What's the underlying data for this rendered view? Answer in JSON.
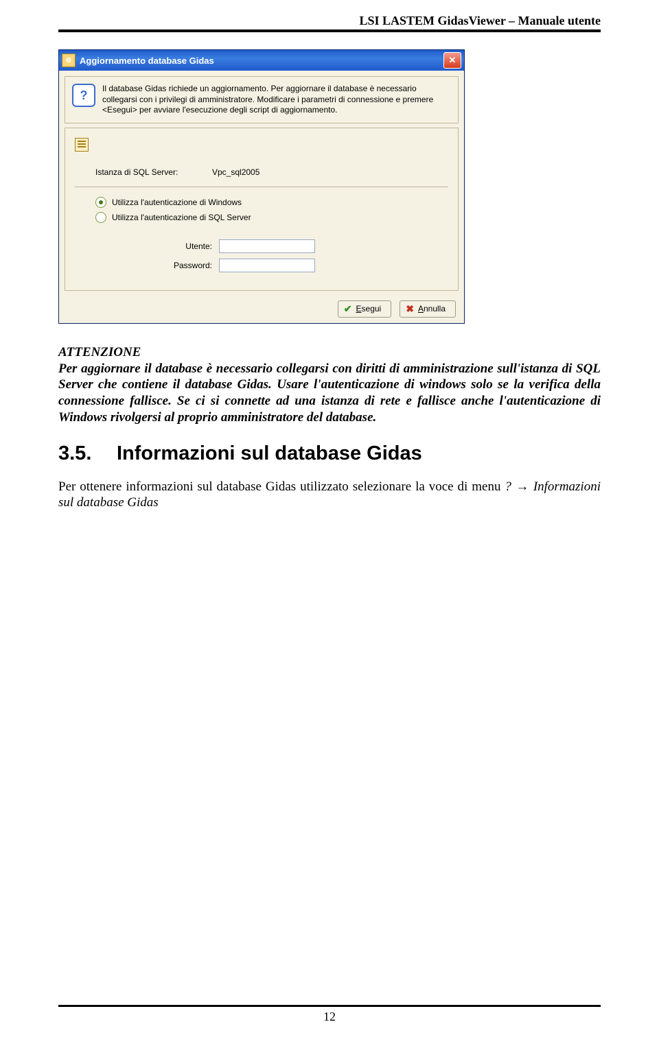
{
  "doc_header": "LSI LASTEM GidasViewer – Manuale utente",
  "dialog": {
    "title": "Aggiornamento database Gidas",
    "info_text": "Il database Gidas richiede un aggiornamento. Per aggiornare il database è necessario collegarsi con i privilegi di amministratore. Modificare i parametri di connessione e premere <Esegui> per avviare l'esecuzione degli script di aggiornamento.",
    "instance_label": "Istanza di SQL Server:",
    "instance_value": "Vpc_sql2005",
    "radio_windows": "Utilizza l'autenticazione di Windows",
    "radio_sql": "Utilizza l'autenticazione di SQL Server",
    "user_label": "Utente:",
    "password_label": "Password:",
    "user_value": "",
    "password_value": "",
    "btn_execute_prefix": "E",
    "btn_execute_rest": "segui",
    "btn_cancel_prefix": "A",
    "btn_cancel_rest": "nnulla"
  },
  "attention_label": "ATTENZIONE",
  "attention_text": "Per aggiornare il database è necessario collegarsi con diritti di amministrazione sull'istanza di SQL Server che contiene il database Gidas. Usare l'autenticazione di windows solo se la verifica della connessione fallisce. Se ci si connette ad una istanza di rete e fallisce anche l'autenticazione di Windows rivolgersi al proprio amministratore del database.",
  "section_number": "3.5.",
  "section_title": "Informazioni sul database Gidas",
  "para2_a": "Per ottenere informazioni sul database Gidas utilizzato selezionare la voce di menu ",
  "para2_menu": "?",
  "para2_arrow": " → ",
  "para2_b": "Informazioni sul database Gidas",
  "page_number": "12"
}
